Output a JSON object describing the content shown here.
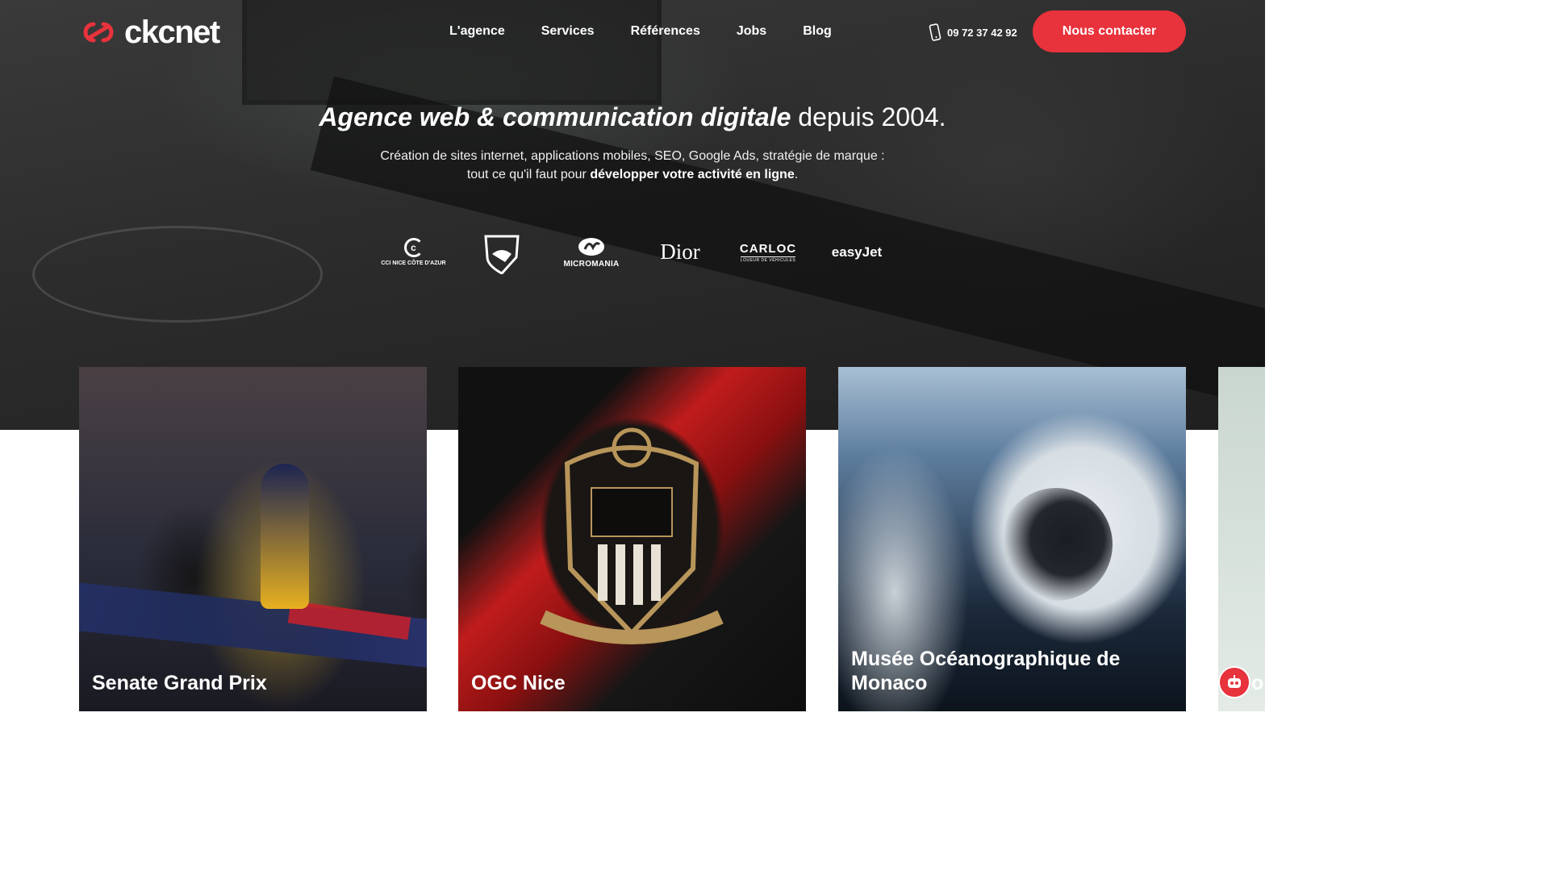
{
  "brand": {
    "name": "ckcnet",
    "accent": "#e8323c"
  },
  "nav": {
    "items": [
      {
        "label": "L'agence"
      },
      {
        "label": "Services"
      },
      {
        "label": "Références"
      },
      {
        "label": "Jobs"
      },
      {
        "label": "Blog"
      }
    ]
  },
  "header": {
    "phone": "09 72 37 42 92",
    "cta_label": "Nous contacter"
  },
  "hero": {
    "headline_strong": "Agence web & communication digitale",
    "headline_light": "depuis 2004.",
    "sub_line1": "Création de sites internet, applications mobiles, SEO, Google Ads, stratégie de marque :",
    "sub_line2_prefix": "tout ce qu'il faut pour",
    "sub_line2_bold": "développer votre activité en ligne",
    "sub_line2_suffix": "."
  },
  "clients": {
    "cci": "CCI NICE CÔTE D'AZUR",
    "sharks": "SHARKS",
    "micromania": "MICROMANIA",
    "dior": "Dior",
    "carloc": "CARLOC",
    "carloc_tagline": "LOUEUR DE VÉHICULES",
    "easyjet": "easyJet"
  },
  "cards": [
    {
      "title": "Senate Grand Prix"
    },
    {
      "title": "OGC Nice"
    },
    {
      "title": "Musée Océanographique de Monaco"
    },
    {
      "title": "or"
    }
  ],
  "icons": {
    "logo": "ckcnet-logo-icon",
    "phone": "phone-icon",
    "chatbot": "chatbot-icon"
  }
}
